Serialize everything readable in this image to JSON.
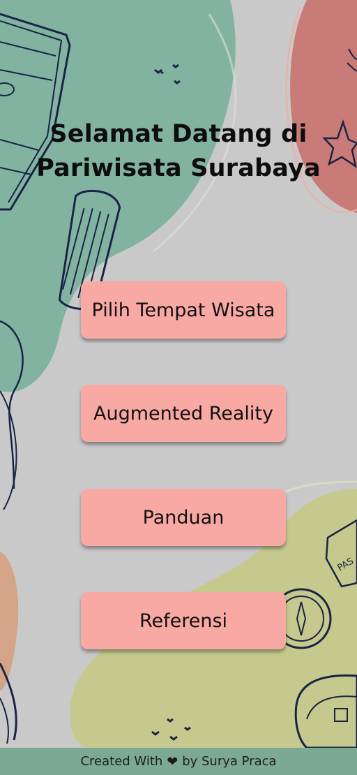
{
  "header": {
    "title_line1": "Selamat Datang di",
    "title_line2": "Pariwisata Surabaya"
  },
  "menu": {
    "items": [
      {
        "label": "Pilih Tempat Wisata"
      },
      {
        "label": "Augmented Reality"
      },
      {
        "label": "Panduan"
      },
      {
        "label": "Referensi"
      }
    ]
  },
  "footer": {
    "prefix": "Created With",
    "icon": "heart-icon",
    "suffix": "by Surya Praca"
  },
  "colors": {
    "background": "#c9c9c9",
    "green_blob": "#82b3a0",
    "red_blob": "#c97b77",
    "yellow_blob": "#c6c98d",
    "button": "#f9a9a3",
    "footer": "#7ba994",
    "line_art": "#1a2344"
  }
}
